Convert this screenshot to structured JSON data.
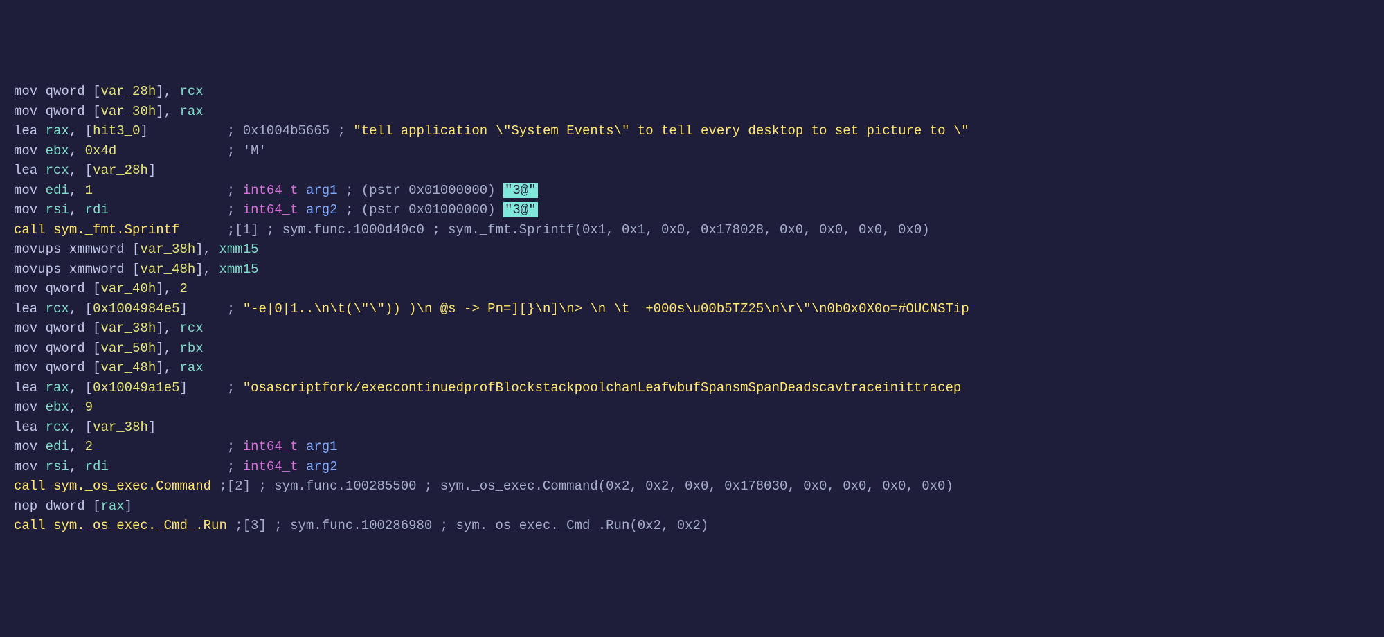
{
  "lines": [
    {
      "segments": [
        {
          "c": "tk-mnemonic",
          "t": "mov"
        },
        {
          "c": "tk-default",
          "t": " qword ["
        },
        {
          "c": "tk-var",
          "t": "var_28h"
        },
        {
          "c": "tk-default",
          "t": "], "
        },
        {
          "c": "tk-reg",
          "t": "rcx"
        }
      ]
    },
    {
      "segments": [
        {
          "c": "tk-mnemonic",
          "t": "mov"
        },
        {
          "c": "tk-default",
          "t": " qword ["
        },
        {
          "c": "tk-var",
          "t": "var_30h"
        },
        {
          "c": "tk-default",
          "t": "], "
        },
        {
          "c": "tk-reg",
          "t": "rax"
        }
      ]
    },
    {
      "segments": [
        {
          "c": "tk-mnemonic",
          "t": "lea"
        },
        {
          "c": "tk-default",
          "t": " "
        },
        {
          "c": "tk-reg",
          "t": "rax"
        },
        {
          "c": "tk-default",
          "t": ", ["
        },
        {
          "c": "tk-var",
          "t": "hit3_0"
        },
        {
          "c": "tk-default",
          "t": "]          "
        },
        {
          "c": "tk-comment",
          "t": "; 0x1004b5665 ; "
        },
        {
          "c": "tk-string",
          "t": "\"tell application \\\"System Events\\\" to tell every desktop to set picture to \\\""
        }
      ]
    },
    {
      "segments": [
        {
          "c": "tk-mnemonic",
          "t": "mov"
        },
        {
          "c": "tk-default",
          "t": " "
        },
        {
          "c": "tk-reg",
          "t": "ebx"
        },
        {
          "c": "tk-default",
          "t": ", "
        },
        {
          "c": "tk-num",
          "t": "0x4d"
        },
        {
          "c": "tk-default",
          "t": "              "
        },
        {
          "c": "tk-comment",
          "t": "; 'M'"
        }
      ]
    },
    {
      "segments": [
        {
          "c": "tk-mnemonic",
          "t": "lea"
        },
        {
          "c": "tk-default",
          "t": " "
        },
        {
          "c": "tk-reg",
          "t": "rcx"
        },
        {
          "c": "tk-default",
          "t": ", ["
        },
        {
          "c": "tk-var",
          "t": "var_28h"
        },
        {
          "c": "tk-default",
          "t": "]"
        }
      ]
    },
    {
      "segments": [
        {
          "c": "tk-mnemonic",
          "t": "mov"
        },
        {
          "c": "tk-default",
          "t": " "
        },
        {
          "c": "tk-reg",
          "t": "edi"
        },
        {
          "c": "tk-default",
          "t": ", "
        },
        {
          "c": "tk-num",
          "t": "1"
        },
        {
          "c": "tk-default",
          "t": "                 "
        },
        {
          "c": "tk-comment",
          "t": "; "
        },
        {
          "c": "tk-type",
          "t": "int64_t"
        },
        {
          "c": "tk-comment",
          "t": " "
        },
        {
          "c": "tk-argname",
          "t": "arg1"
        },
        {
          "c": "tk-comment",
          "t": " ; (pstr 0x01000000) "
        },
        {
          "c": "tk-highlight",
          "t": "\"3@\""
        }
      ]
    },
    {
      "segments": [
        {
          "c": "tk-mnemonic",
          "t": "mov"
        },
        {
          "c": "tk-default",
          "t": " "
        },
        {
          "c": "tk-reg",
          "t": "rsi"
        },
        {
          "c": "tk-default",
          "t": ", "
        },
        {
          "c": "tk-reg",
          "t": "rdi"
        },
        {
          "c": "tk-default",
          "t": "               "
        },
        {
          "c": "tk-comment",
          "t": "; "
        },
        {
          "c": "tk-type",
          "t": "int64_t"
        },
        {
          "c": "tk-comment",
          "t": " "
        },
        {
          "c": "tk-argname",
          "t": "arg2"
        },
        {
          "c": "tk-comment",
          "t": " ; (pstr 0x01000000) "
        },
        {
          "c": "tk-highlight",
          "t": "\"3@\""
        }
      ]
    },
    {
      "segments": [
        {
          "c": "tk-call-target",
          "t": "call sym._fmt.Sprintf"
        },
        {
          "c": "tk-default",
          "t": "      "
        },
        {
          "c": "tk-comment",
          "t": ";[1] ; sym.func.1000d40c0 ; sym._fmt.Sprintf(0x1, 0x1, 0x0, 0x178028, 0x0, 0x0, 0x0, 0x0)"
        }
      ]
    },
    {
      "segments": [
        {
          "c": "tk-mnemonic",
          "t": "movups"
        },
        {
          "c": "tk-default",
          "t": " xmmword ["
        },
        {
          "c": "tk-var",
          "t": "var_38h"
        },
        {
          "c": "tk-default",
          "t": "], "
        },
        {
          "c": "tk-reg",
          "t": "xmm15"
        }
      ]
    },
    {
      "segments": [
        {
          "c": "tk-mnemonic",
          "t": "movups"
        },
        {
          "c": "tk-default",
          "t": " xmmword ["
        },
        {
          "c": "tk-var",
          "t": "var_48h"
        },
        {
          "c": "tk-default",
          "t": "], "
        },
        {
          "c": "tk-reg",
          "t": "xmm15"
        }
      ]
    },
    {
      "segments": [
        {
          "c": "tk-mnemonic",
          "t": "mov"
        },
        {
          "c": "tk-default",
          "t": " qword ["
        },
        {
          "c": "tk-var",
          "t": "var_40h"
        },
        {
          "c": "tk-default",
          "t": "], "
        },
        {
          "c": "tk-num",
          "t": "2"
        }
      ]
    },
    {
      "segments": [
        {
          "c": "tk-mnemonic",
          "t": "lea"
        },
        {
          "c": "tk-default",
          "t": " "
        },
        {
          "c": "tk-reg",
          "t": "rcx"
        },
        {
          "c": "tk-default",
          "t": ", ["
        },
        {
          "c": "tk-num",
          "t": "0x1004984e5"
        },
        {
          "c": "tk-default",
          "t": "]     "
        },
        {
          "c": "tk-comment",
          "t": "; "
        },
        {
          "c": "tk-string",
          "t": "\"-e|0|1..\\n\\t(\\\"\\\")) )\\n @s -> Pn=][}\\n]\\n> \\n \\t  +000s\\u00b5TZ25\\n\\r\\\"\\n0b0x0X0o=#OUCNSTip"
        }
      ]
    },
    {
      "segments": [
        {
          "c": "tk-mnemonic",
          "t": "mov"
        },
        {
          "c": "tk-default",
          "t": " qword ["
        },
        {
          "c": "tk-var",
          "t": "var_38h"
        },
        {
          "c": "tk-default",
          "t": "], "
        },
        {
          "c": "tk-reg",
          "t": "rcx"
        }
      ]
    },
    {
      "segments": [
        {
          "c": "tk-mnemonic",
          "t": "mov"
        },
        {
          "c": "tk-default",
          "t": " qword ["
        },
        {
          "c": "tk-var",
          "t": "var_50h"
        },
        {
          "c": "tk-default",
          "t": "], "
        },
        {
          "c": "tk-reg",
          "t": "rbx"
        }
      ]
    },
    {
      "segments": [
        {
          "c": "tk-mnemonic",
          "t": "mov"
        },
        {
          "c": "tk-default",
          "t": " qword ["
        },
        {
          "c": "tk-var",
          "t": "var_48h"
        },
        {
          "c": "tk-default",
          "t": "], "
        },
        {
          "c": "tk-reg",
          "t": "rax"
        }
      ]
    },
    {
      "segments": [
        {
          "c": "tk-mnemonic",
          "t": "lea"
        },
        {
          "c": "tk-default",
          "t": " "
        },
        {
          "c": "tk-reg",
          "t": "rax"
        },
        {
          "c": "tk-default",
          "t": ", ["
        },
        {
          "c": "tk-num",
          "t": "0x10049a1e5"
        },
        {
          "c": "tk-default",
          "t": "]     "
        },
        {
          "c": "tk-comment",
          "t": "; "
        },
        {
          "c": "tk-string",
          "t": "\"osascriptfork/execcontinuedprofBlockstackpoolchanLeafwbufSpansmSpanDeadscavtraceinittracep"
        }
      ]
    },
    {
      "segments": [
        {
          "c": "tk-mnemonic",
          "t": "mov"
        },
        {
          "c": "tk-default",
          "t": " "
        },
        {
          "c": "tk-reg",
          "t": "ebx"
        },
        {
          "c": "tk-default",
          "t": ", "
        },
        {
          "c": "tk-num",
          "t": "9"
        }
      ]
    },
    {
      "segments": [
        {
          "c": "tk-mnemonic",
          "t": "lea"
        },
        {
          "c": "tk-default",
          "t": " "
        },
        {
          "c": "tk-reg",
          "t": "rcx"
        },
        {
          "c": "tk-default",
          "t": ", ["
        },
        {
          "c": "tk-var",
          "t": "var_38h"
        },
        {
          "c": "tk-default",
          "t": "]"
        }
      ]
    },
    {
      "segments": [
        {
          "c": "tk-mnemonic",
          "t": "mov"
        },
        {
          "c": "tk-default",
          "t": " "
        },
        {
          "c": "tk-reg",
          "t": "edi"
        },
        {
          "c": "tk-default",
          "t": ", "
        },
        {
          "c": "tk-num",
          "t": "2"
        },
        {
          "c": "tk-default",
          "t": "                 "
        },
        {
          "c": "tk-comment",
          "t": "; "
        },
        {
          "c": "tk-type",
          "t": "int64_t"
        },
        {
          "c": "tk-comment",
          "t": " "
        },
        {
          "c": "tk-argname",
          "t": "arg1"
        }
      ]
    },
    {
      "segments": [
        {
          "c": "tk-mnemonic",
          "t": "mov"
        },
        {
          "c": "tk-default",
          "t": " "
        },
        {
          "c": "tk-reg",
          "t": "rsi"
        },
        {
          "c": "tk-default",
          "t": ", "
        },
        {
          "c": "tk-reg",
          "t": "rdi"
        },
        {
          "c": "tk-default",
          "t": "               "
        },
        {
          "c": "tk-comment",
          "t": "; "
        },
        {
          "c": "tk-type",
          "t": "int64_t"
        },
        {
          "c": "tk-comment",
          "t": " "
        },
        {
          "c": "tk-argname",
          "t": "arg2"
        }
      ]
    },
    {
      "segments": [
        {
          "c": "tk-call-target",
          "t": "call sym._os_exec.Command"
        },
        {
          "c": "tk-default",
          "t": " "
        },
        {
          "c": "tk-comment",
          "t": ";[2] ; sym.func.100285500 ; sym._os_exec.Command(0x2, 0x2, 0x0, 0x178030, 0x0, 0x0, 0x0, 0x0)"
        }
      ]
    },
    {
      "segments": [
        {
          "c": "tk-mnemonic",
          "t": "nop"
        },
        {
          "c": "tk-default",
          "t": " dword ["
        },
        {
          "c": "tk-reg",
          "t": "rax"
        },
        {
          "c": "tk-default",
          "t": "]"
        }
      ]
    },
    {
      "segments": [
        {
          "c": "tk-call-target",
          "t": "call sym._os_exec._Cmd_.Run"
        },
        {
          "c": "tk-default",
          "t": " "
        },
        {
          "c": "tk-comment",
          "t": ";[3] ; sym.func.100286980 ; sym._os_exec._Cmd_.Run(0x2, 0x2)"
        }
      ]
    }
  ]
}
